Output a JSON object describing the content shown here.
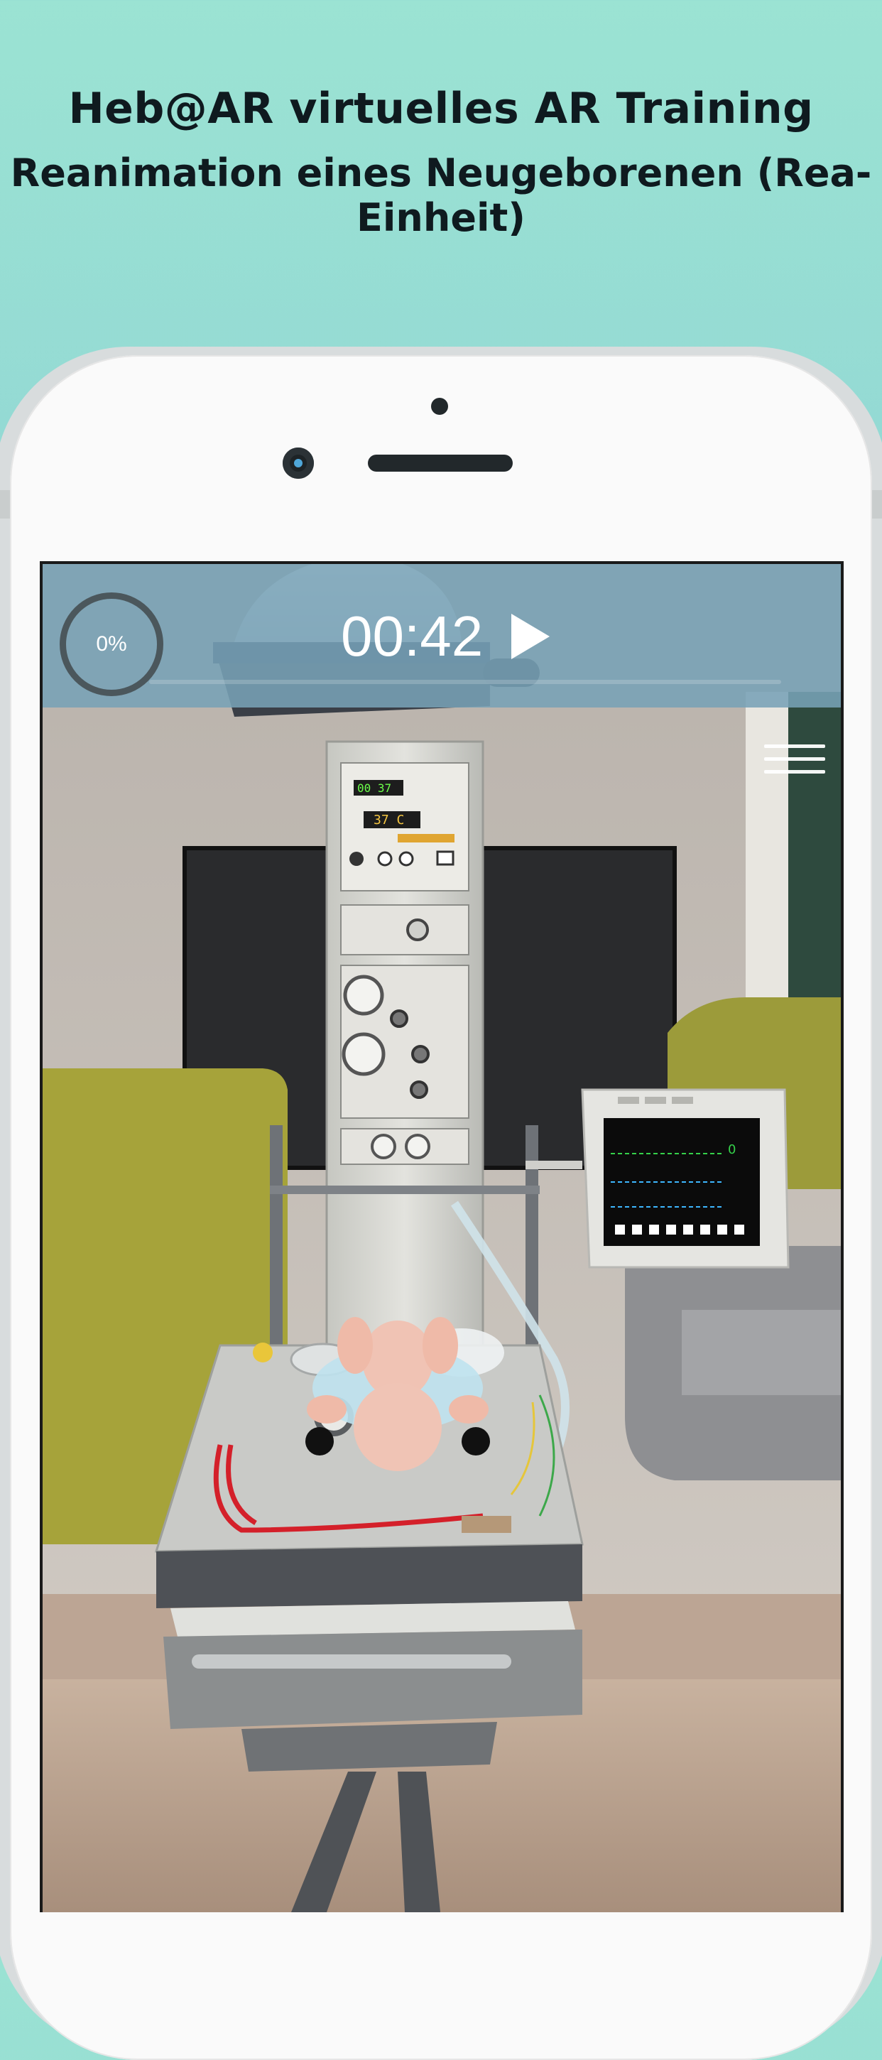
{
  "header": {
    "title": "Heb@AR virtuelles AR Training",
    "subtitle": "Reanimation eines Neugeborenen (Rea-Einheit)"
  },
  "hud": {
    "progress_label": "0%",
    "progress_value": 0,
    "timer": "00:42"
  },
  "scene": {
    "incubator_display_1": "00 37",
    "incubator_display_2": "37 C",
    "monitor_value": "0"
  },
  "colors": {
    "background_top": "#9be3d3",
    "background_bottom": "#82c4d2",
    "hud_bar": "#78a2b6",
    "headline_text": "#0f1a1f"
  },
  "icons": {
    "play": "play-icon",
    "menu": "hamburger-menu-icon"
  }
}
